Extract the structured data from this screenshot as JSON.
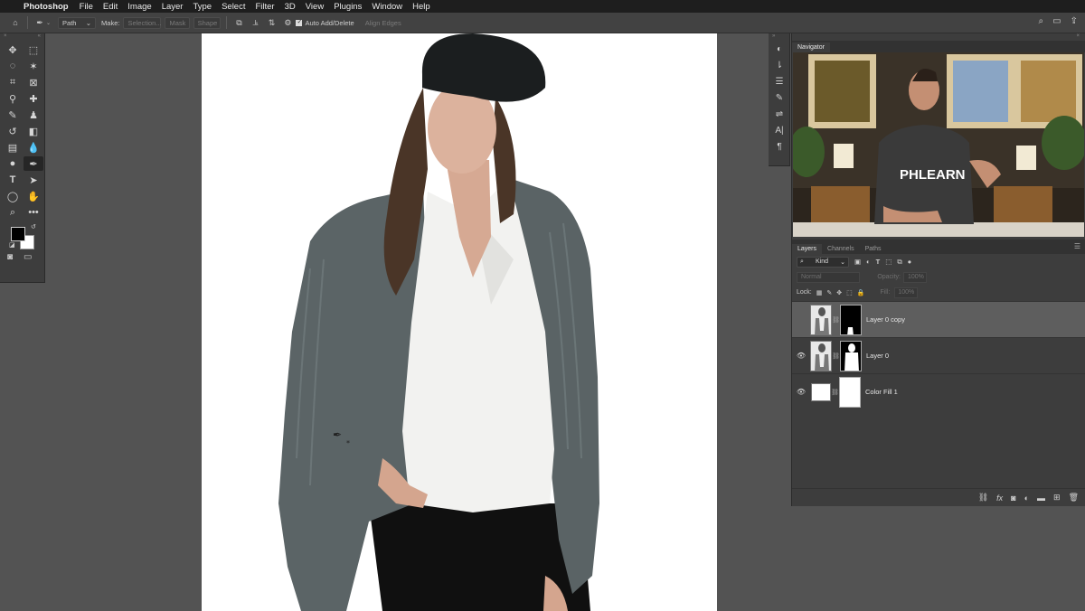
{
  "menubar": {
    "app_name": "Photoshop",
    "items": [
      "File",
      "Edit",
      "Image",
      "Layer",
      "Type",
      "Select",
      "Filter",
      "3D",
      "View",
      "Plugins",
      "Window",
      "Help"
    ]
  },
  "options_bar": {
    "mode_value": "Path",
    "make_label": "Make:",
    "selection_button": "Selection...",
    "mask_button": "Mask",
    "shape_button": "Shape",
    "auto_add_delete_label": "Auto Add/Delete",
    "align_edges_label": "Align Edges"
  },
  "navigator": {
    "tab_label": "Navigator",
    "shirt_text": "PHLEARN"
  },
  "layers_panel": {
    "tabs": [
      "Layers",
      "Channels",
      "Paths"
    ],
    "filter_kind": "Kind",
    "blend_mode": "Normal",
    "opacity_label": "Opacity:",
    "opacity_value": "100%",
    "lock_label": "Lock:",
    "fill_label": "Fill:",
    "fill_value": "100%",
    "layers": [
      {
        "name": "Layer 0 copy",
        "visible": false,
        "selected": true
      },
      {
        "name": "Layer 0",
        "visible": true,
        "selected": false
      },
      {
        "name": "Color Fill 1",
        "visible": true,
        "selected": false
      }
    ]
  },
  "colors": {
    "foreground": "#000000",
    "background": "#ffffff",
    "ui_dark": "#3d3d3d",
    "canvas_bg": "#535353"
  }
}
